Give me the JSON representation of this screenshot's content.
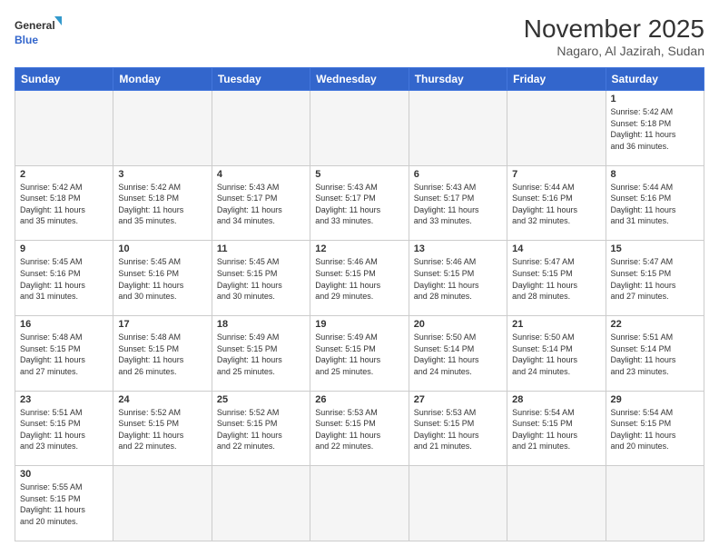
{
  "header": {
    "logo_general": "General",
    "logo_blue": "Blue",
    "month_title": "November 2025",
    "location": "Nagaro, Al Jazirah, Sudan"
  },
  "days_of_week": [
    "Sunday",
    "Monday",
    "Tuesday",
    "Wednesday",
    "Thursday",
    "Friday",
    "Saturday"
  ],
  "weeks": [
    [
      {
        "day": "",
        "info": ""
      },
      {
        "day": "",
        "info": ""
      },
      {
        "day": "",
        "info": ""
      },
      {
        "day": "",
        "info": ""
      },
      {
        "day": "",
        "info": ""
      },
      {
        "day": "",
        "info": ""
      },
      {
        "day": "1",
        "info": "Sunrise: 5:42 AM\nSunset: 5:18 PM\nDaylight: 11 hours\nand 36 minutes."
      }
    ],
    [
      {
        "day": "2",
        "info": "Sunrise: 5:42 AM\nSunset: 5:18 PM\nDaylight: 11 hours\nand 35 minutes."
      },
      {
        "day": "3",
        "info": "Sunrise: 5:42 AM\nSunset: 5:18 PM\nDaylight: 11 hours\nand 35 minutes."
      },
      {
        "day": "4",
        "info": "Sunrise: 5:43 AM\nSunset: 5:17 PM\nDaylight: 11 hours\nand 34 minutes."
      },
      {
        "day": "5",
        "info": "Sunrise: 5:43 AM\nSunset: 5:17 PM\nDaylight: 11 hours\nand 33 minutes."
      },
      {
        "day": "6",
        "info": "Sunrise: 5:43 AM\nSunset: 5:17 PM\nDaylight: 11 hours\nand 33 minutes."
      },
      {
        "day": "7",
        "info": "Sunrise: 5:44 AM\nSunset: 5:16 PM\nDaylight: 11 hours\nand 32 minutes."
      },
      {
        "day": "8",
        "info": "Sunrise: 5:44 AM\nSunset: 5:16 PM\nDaylight: 11 hours\nand 31 minutes."
      }
    ],
    [
      {
        "day": "9",
        "info": "Sunrise: 5:45 AM\nSunset: 5:16 PM\nDaylight: 11 hours\nand 31 minutes."
      },
      {
        "day": "10",
        "info": "Sunrise: 5:45 AM\nSunset: 5:16 PM\nDaylight: 11 hours\nand 30 minutes."
      },
      {
        "day": "11",
        "info": "Sunrise: 5:45 AM\nSunset: 5:15 PM\nDaylight: 11 hours\nand 30 minutes."
      },
      {
        "day": "12",
        "info": "Sunrise: 5:46 AM\nSunset: 5:15 PM\nDaylight: 11 hours\nand 29 minutes."
      },
      {
        "day": "13",
        "info": "Sunrise: 5:46 AM\nSunset: 5:15 PM\nDaylight: 11 hours\nand 28 minutes."
      },
      {
        "day": "14",
        "info": "Sunrise: 5:47 AM\nSunset: 5:15 PM\nDaylight: 11 hours\nand 28 minutes."
      },
      {
        "day": "15",
        "info": "Sunrise: 5:47 AM\nSunset: 5:15 PM\nDaylight: 11 hours\nand 27 minutes."
      }
    ],
    [
      {
        "day": "16",
        "info": "Sunrise: 5:48 AM\nSunset: 5:15 PM\nDaylight: 11 hours\nand 27 minutes."
      },
      {
        "day": "17",
        "info": "Sunrise: 5:48 AM\nSunset: 5:15 PM\nDaylight: 11 hours\nand 26 minutes."
      },
      {
        "day": "18",
        "info": "Sunrise: 5:49 AM\nSunset: 5:15 PM\nDaylight: 11 hours\nand 25 minutes."
      },
      {
        "day": "19",
        "info": "Sunrise: 5:49 AM\nSunset: 5:15 PM\nDaylight: 11 hours\nand 25 minutes."
      },
      {
        "day": "20",
        "info": "Sunrise: 5:50 AM\nSunset: 5:14 PM\nDaylight: 11 hours\nand 24 minutes."
      },
      {
        "day": "21",
        "info": "Sunrise: 5:50 AM\nSunset: 5:14 PM\nDaylight: 11 hours\nand 24 minutes."
      },
      {
        "day": "22",
        "info": "Sunrise: 5:51 AM\nSunset: 5:14 PM\nDaylight: 11 hours\nand 23 minutes."
      }
    ],
    [
      {
        "day": "23",
        "info": "Sunrise: 5:51 AM\nSunset: 5:15 PM\nDaylight: 11 hours\nand 23 minutes."
      },
      {
        "day": "24",
        "info": "Sunrise: 5:52 AM\nSunset: 5:15 PM\nDaylight: 11 hours\nand 22 minutes."
      },
      {
        "day": "25",
        "info": "Sunrise: 5:52 AM\nSunset: 5:15 PM\nDaylight: 11 hours\nand 22 minutes."
      },
      {
        "day": "26",
        "info": "Sunrise: 5:53 AM\nSunset: 5:15 PM\nDaylight: 11 hours\nand 22 minutes."
      },
      {
        "day": "27",
        "info": "Sunrise: 5:53 AM\nSunset: 5:15 PM\nDaylight: 11 hours\nand 21 minutes."
      },
      {
        "day": "28",
        "info": "Sunrise: 5:54 AM\nSunset: 5:15 PM\nDaylight: 11 hours\nand 21 minutes."
      },
      {
        "day": "29",
        "info": "Sunrise: 5:54 AM\nSunset: 5:15 PM\nDaylight: 11 hours\nand 20 minutes."
      }
    ],
    [
      {
        "day": "30",
        "info": "Sunrise: 5:55 AM\nSunset: 5:15 PM\nDaylight: 11 hours\nand 20 minutes."
      },
      {
        "day": "",
        "info": ""
      },
      {
        "day": "",
        "info": ""
      },
      {
        "day": "",
        "info": ""
      },
      {
        "day": "",
        "info": ""
      },
      {
        "day": "",
        "info": ""
      },
      {
        "day": "",
        "info": ""
      }
    ]
  ]
}
